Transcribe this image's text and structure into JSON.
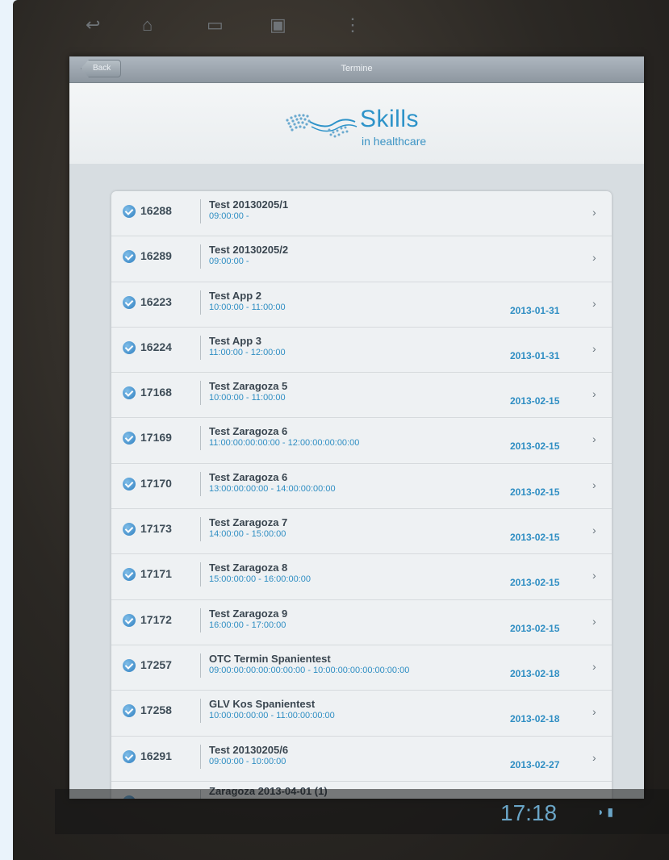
{
  "header": {
    "back_label": "Back",
    "title": "Termine"
  },
  "logo": {
    "name": "Skills",
    "tagline": "in healthcare"
  },
  "appointments": [
    {
      "id": "16288",
      "title": "Test 20130205/1",
      "time": "09:00:00 -",
      "date": ""
    },
    {
      "id": "16289",
      "title": "Test 20130205/2",
      "time": "09:00:00 -",
      "date": ""
    },
    {
      "id": "16223",
      "title": "Test App 2",
      "time": "10:00:00 - 11:00:00",
      "date": "2013-01-31"
    },
    {
      "id": "16224",
      "title": "Test App 3",
      "time": "11:00:00 - 12:00:00",
      "date": "2013-01-31"
    },
    {
      "id": "17168",
      "title": "Test Zaragoza 5",
      "time": "10:00:00 - 11:00:00",
      "date": "2013-02-15"
    },
    {
      "id": "17169",
      "title": "Test Zaragoza 6",
      "time": "11:00:00:00:00:00 - 12:00:00:00:00:00",
      "date": "2013-02-15"
    },
    {
      "id": "17170",
      "title": "Test Zaragoza 6",
      "time": "13:00:00:00:00 - 14:00:00:00:00",
      "date": "2013-02-15"
    },
    {
      "id": "17173",
      "title": "Test Zaragoza 7",
      "time": "14:00:00 - 15:00:00",
      "date": "2013-02-15"
    },
    {
      "id": "17171",
      "title": "Test Zaragoza 8",
      "time": "15:00:00:00 - 16:00:00:00",
      "date": "2013-02-15"
    },
    {
      "id": "17172",
      "title": "Test Zaragoza 9",
      "time": "16:00:00 - 17:00:00",
      "date": "2013-02-15"
    },
    {
      "id": "17257",
      "title": "OTC Termin Spanientest",
      "time": "09:00:00:00:00:00:00:00 - 10:00:00:00:00:00:00:00",
      "date": "2013-02-18"
    },
    {
      "id": "17258",
      "title": "GLV Kos Spanientest",
      "time": "10:00:00:00:00 - 11:00:00:00:00",
      "date": "2013-02-18"
    },
    {
      "id": "16291",
      "title": "Test 20130205/6",
      "time": "09:00:00 - 10:00:00",
      "date": "2013-02-27"
    },
    {
      "id": "",
      "title": "Zaragoza 2013-04-01 (1)",
      "time": "",
      "date": ""
    }
  ],
  "status_bar": {
    "clock": "17:18"
  },
  "icons": {
    "check": "check-circle-icon",
    "chevron": "chevron-right-icon",
    "back_nav": "back-nav-icon",
    "home_nav": "home-nav-icon",
    "recent_nav": "recent-apps-icon",
    "screenshot_nav": "screenshot-icon",
    "menu_nav": "menu-dots-icon",
    "wifi": "wifi-icon",
    "battery": "battery-icon"
  },
  "colors": {
    "accent": "#2f8ec3",
    "topbar": "#9aa3ab",
    "clock": "#6aa5c7"
  }
}
